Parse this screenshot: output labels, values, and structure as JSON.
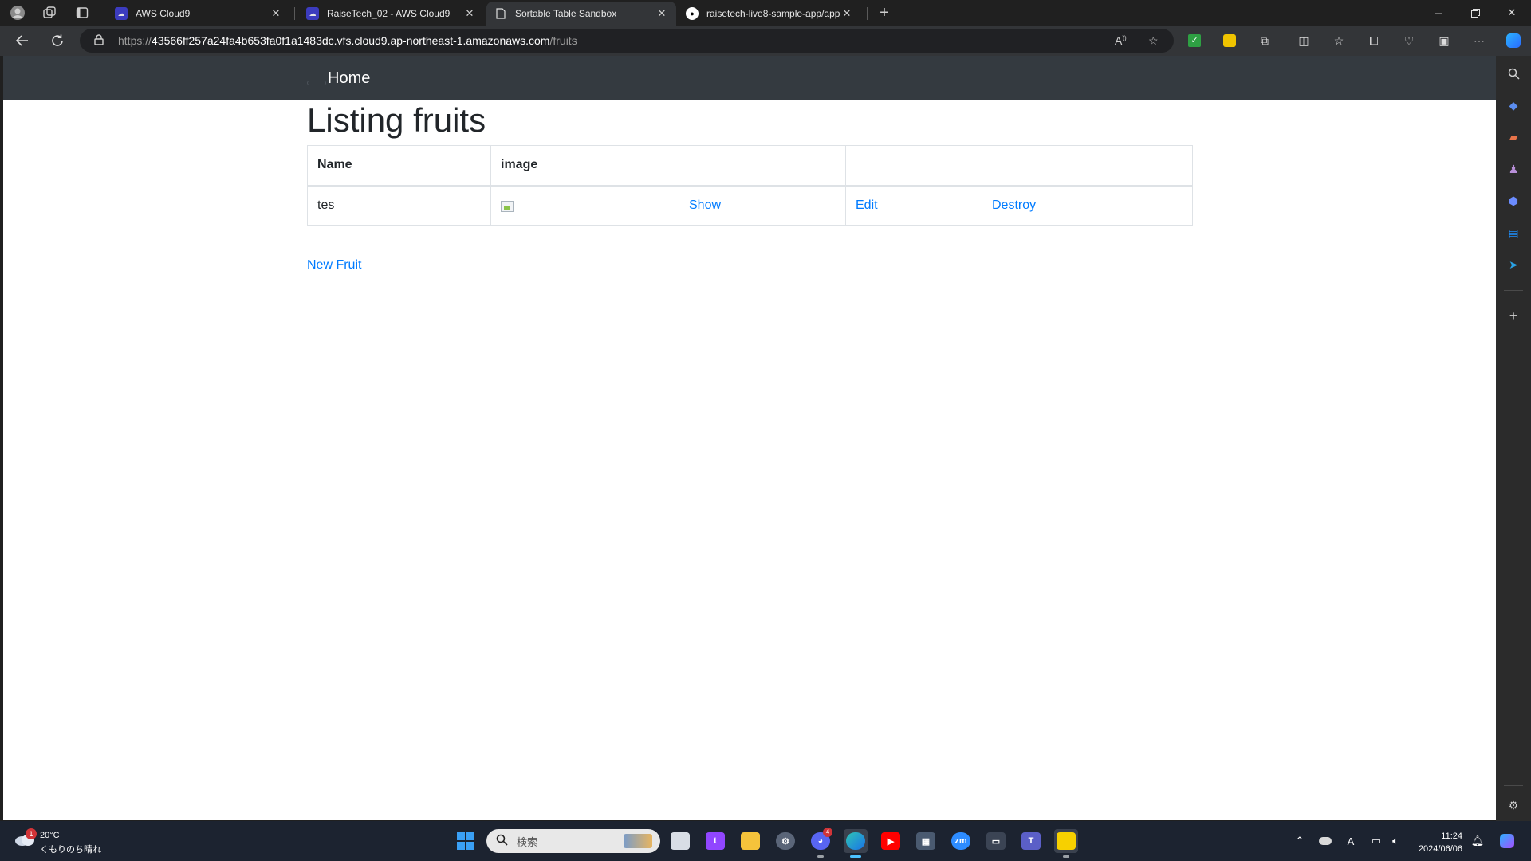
{
  "browser": {
    "tabs": [
      {
        "label": "AWS Cloud9",
        "active": false
      },
      {
        "label": "RaiseTech_02 - AWS Cloud9",
        "active": false
      },
      {
        "label": "Sortable Table Sandbox",
        "active": true
      },
      {
        "label": "raisetech-live8-sample-app/app/",
        "active": false
      }
    ],
    "new_tab_symbol": "+",
    "address": {
      "scheme": "https://",
      "host": "43566ff257a24fa4b653fa0f1a1483dc.vfs.cloud9.ap-northeast-1.amazonaws.com",
      "path": "/fruits"
    }
  },
  "page": {
    "brand": "Home",
    "heading": "Listing fruits",
    "table": {
      "headers": [
        "Name",
        "image",
        "",
        "",
        ""
      ],
      "rows": [
        {
          "name": "tes",
          "show": "Show",
          "edit": "Edit",
          "destroy": "Destroy"
        }
      ]
    },
    "new_link": "New Fruit",
    "link_color": "#007bff"
  },
  "taskbar": {
    "weather": {
      "badge": "1",
      "temp": "20°C",
      "desc": "くもりのち晴れ"
    },
    "search_placeholder": "検索",
    "apps": [
      "windows-start",
      "search",
      "task-view",
      "twitch",
      "file-explorer",
      "settings",
      "discord",
      "edge",
      "youtube",
      "calculator",
      "zoom",
      "keyboard",
      "teams",
      "sticky-notes"
    ],
    "discord_badge": "4",
    "clock": {
      "time": "11:24",
      "date": "2024/06/06"
    }
  }
}
